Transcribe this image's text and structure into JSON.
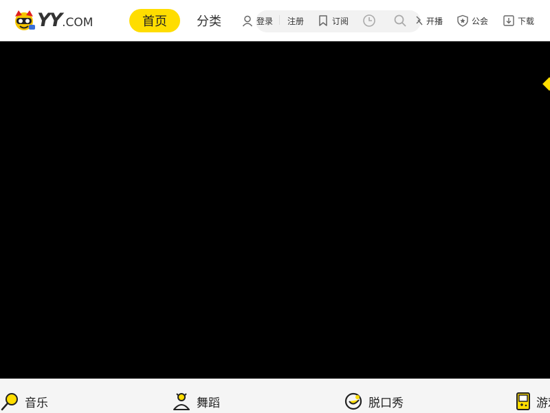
{
  "header": {
    "logo": {
      "yy": "YY",
      "com": ".COM"
    },
    "nav": {
      "home": "首页",
      "category": "分类"
    },
    "login": "登录",
    "register": "注册",
    "subscribe": "订阅",
    "broadcast": "开播",
    "guild": "公会",
    "download": "下载"
  },
  "colors": {
    "accent": "#ffdd00",
    "player_bg": "#000000",
    "catbar_bg": "#f5f5f5"
  },
  "categories": [
    {
      "label": "音乐",
      "icon": "microphone-icon"
    },
    {
      "label": "舞蹈",
      "icon": "dancer-icon"
    },
    {
      "label": "脱口秀",
      "icon": "smile-icon"
    },
    {
      "label": "游戏",
      "icon": "gamepad-icon"
    }
  ]
}
